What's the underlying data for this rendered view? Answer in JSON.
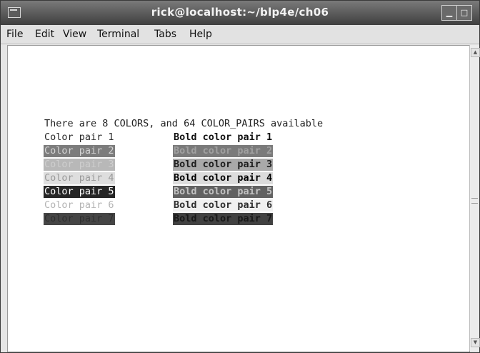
{
  "window": {
    "title": "rick@localhost:~/blp4e/ch06"
  },
  "menu": {
    "file": "File",
    "edit": "Edit",
    "view": "View",
    "terminal": "Terminal",
    "tabs": "Tabs",
    "help": "Help"
  },
  "controls": {
    "minimize": "▁",
    "maximize": "□",
    "close": "✕"
  },
  "terminal": {
    "header": "There are 8 COLORS, and 64 COLOR_PAIRS available",
    "pairs": [
      {
        "normal": "Color pair 1",
        "bold": "Bold color pair 1"
      },
      {
        "normal": "Color pair 2",
        "bold": "Bold color pair 2"
      },
      {
        "normal": "Color pair 3",
        "bold": "Bold color pair 3"
      },
      {
        "normal": "Color pair 4",
        "bold": "Bold color pair 4"
      },
      {
        "normal": "Color pair 5",
        "bold": "Bold color pair 5"
      },
      {
        "normal": "Color pair 6",
        "bold": "Bold color pair 6"
      },
      {
        "normal": "Color pair 7",
        "bold": "Bold color pair 7"
      }
    ]
  },
  "scrollbar": {
    "up": "▲",
    "down": "▼"
  }
}
